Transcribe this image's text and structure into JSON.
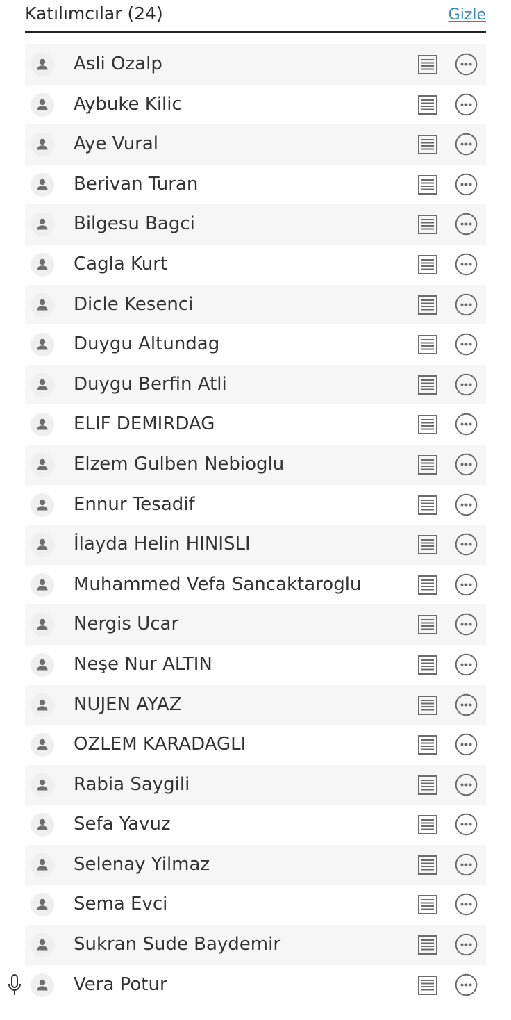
{
  "header": {
    "title": "Katılımcılar (24)",
    "hide_link": "Gizle"
  },
  "participants": [
    {
      "name": "Asli Ozalp"
    },
    {
      "name": "Aybuke Kilic"
    },
    {
      "name": "Aye Vural"
    },
    {
      "name": "Berivan Turan"
    },
    {
      "name": "Bilgesu Bagci"
    },
    {
      "name": "Cagla Kurt"
    },
    {
      "name": "Dicle Kesenci"
    },
    {
      "name": "Duygu Altundag"
    },
    {
      "name": "Duygu Berfin Atli"
    },
    {
      "name": "ELIF DEMIRDAG"
    },
    {
      "name": "Elzem Gulben Nebioglu"
    },
    {
      "name": "Ennur Tesadif"
    },
    {
      "name": "İlayda Helin HINISLI"
    },
    {
      "name": "Muhammed Vefa Sancaktaroglu"
    },
    {
      "name": "Nergis Ucar"
    },
    {
      "name": "Neşe Nur ALTIN"
    },
    {
      "name": "NUJEN AYAZ"
    },
    {
      "name": "OZLEM KARADAGLI"
    },
    {
      "name": "Rabia Saygili"
    },
    {
      "name": "Sefa Yavuz"
    },
    {
      "name": "Selenay Yilmaz"
    },
    {
      "name": "Sema Evci"
    },
    {
      "name": "Sukran Sude Baydemir"
    },
    {
      "name": "Vera Potur",
      "mic_icon": "microphone-icon"
    }
  ],
  "icons": {
    "avatar": "user-avatar-icon",
    "notes": "notes-list-icon",
    "more": "more-options-icon",
    "mic": "microphone-icon"
  },
  "colors": {
    "link": "#3a86b7",
    "header_rule": "#222222",
    "row_alt": "#f6f6f6",
    "icon": "#6b6b6b"
  }
}
